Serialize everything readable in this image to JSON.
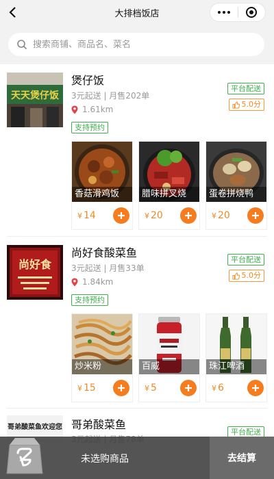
{
  "nav": {
    "title": "大排档饭店"
  },
  "search": {
    "placeholder": "搜索商铺、商品名、菜名"
  },
  "stores": [
    {
      "name": "煲仔饭",
      "meta": "3元起送 | 月售202单",
      "distance": "1.61km",
      "reserve_tag": "支持预约",
      "platform_tag": "平台配送",
      "rating": "5.0分",
      "sign_text": "天天煲仔饭",
      "dishes": [
        {
          "name": "香菇滑鸡饭",
          "currency": "¥",
          "price": "14"
        },
        {
          "name": "腊味拼叉烧",
          "currency": "¥",
          "price": "20"
        },
        {
          "name": "蛋卷拼烧鸭",
          "currency": "¥",
          "price": "20"
        }
      ]
    },
    {
      "name": "尚好食酸菜鱼",
      "meta": "3元起送 | 月售33单",
      "distance": "1.84km",
      "reserve_tag": "支持预约",
      "platform_tag": "平台配送",
      "rating": "5.0分",
      "sign_text": "尚好食",
      "dishes": [
        {
          "name": "炒米粉",
          "currency": "¥",
          "price": "15"
        },
        {
          "name": "百威",
          "currency": "¥",
          "price": "5"
        },
        {
          "name": "珠江啤酒",
          "currency": "¥",
          "price": "6"
        }
      ]
    },
    {
      "name": "哥弟酸菜鱼",
      "meta": "3元起送 | 月售78单",
      "platform_tag": "平台配送",
      "sign_text": "哥弟酸菜鱼欢迎您"
    }
  ],
  "cart": {
    "empty_text": "未选购商品",
    "checkout_label": "去结算"
  },
  "colors": {
    "accent": "#f57c1f",
    "green": "#3fae4c",
    "price": "#f08a24"
  }
}
